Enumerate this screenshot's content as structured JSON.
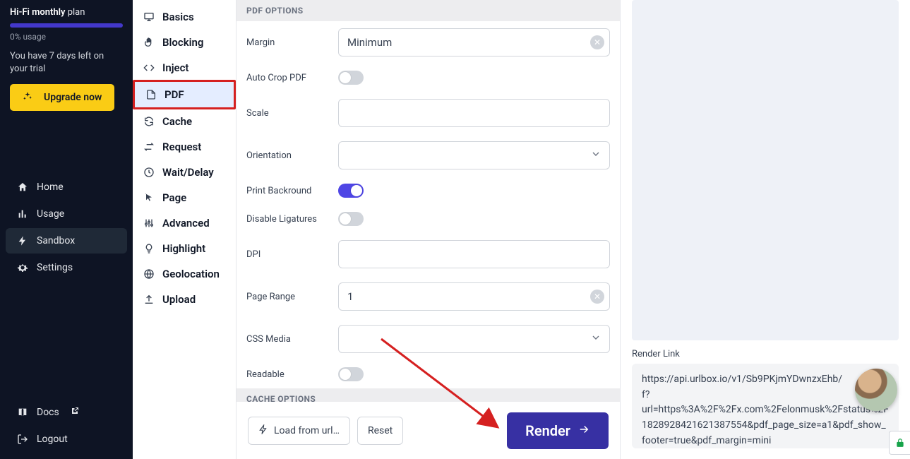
{
  "plan": {
    "name": "Hi-Fi monthly",
    "suffix": "plan",
    "usage": "0% usage",
    "trial_text": "You have 7 days left on your trial",
    "upgrade_label": "Upgrade now"
  },
  "nav": {
    "home": "Home",
    "usage": "Usage",
    "sandbox": "Sandbox",
    "settings": "Settings",
    "docs": "Docs",
    "logout": "Logout"
  },
  "options": {
    "basics": "Basics",
    "blocking": "Blocking",
    "inject": "Inject",
    "pdf": "PDF",
    "cache": "Cache",
    "request": "Request",
    "wait": "Wait/Delay",
    "page": "Page",
    "advanced": "Advanced",
    "highlight": "Highlight",
    "geolocation": "Geolocation",
    "upload": "Upload"
  },
  "sections": {
    "pdf_options": "PDF OPTIONS",
    "cache_options": "CACHE OPTIONS"
  },
  "form": {
    "margin_label": "Margin",
    "margin_value": "Minimum",
    "auto_crop_label": "Auto Crop PDF",
    "scale_label": "Scale",
    "scale_value": "",
    "orientation_label": "Orientation",
    "print_bg_label": "Print Backround",
    "disable_lig_label": "Disable Ligatures",
    "dpi_label": "DPI",
    "dpi_value": "",
    "page_range_label": "Page Range",
    "page_range_value": "1",
    "css_media_label": "CSS Media",
    "readable_label": "Readable"
  },
  "actions": {
    "load_url_label": "Load from url…",
    "reset_label": "Reset",
    "render_label": "Render"
  },
  "preview": {
    "render_link_label": "Render Link",
    "render_link_value": "https://api.urlbox.io/v1/Sb9PKjmYDwnzxEhb/\nf?\nurl=https%3A%2F%2Fx.com%2Felonmusk%2Fstatus%2F1828928421621387554&pdf_page_size=a1&pdf_show_footer=true&pdf_margin=mini"
  }
}
